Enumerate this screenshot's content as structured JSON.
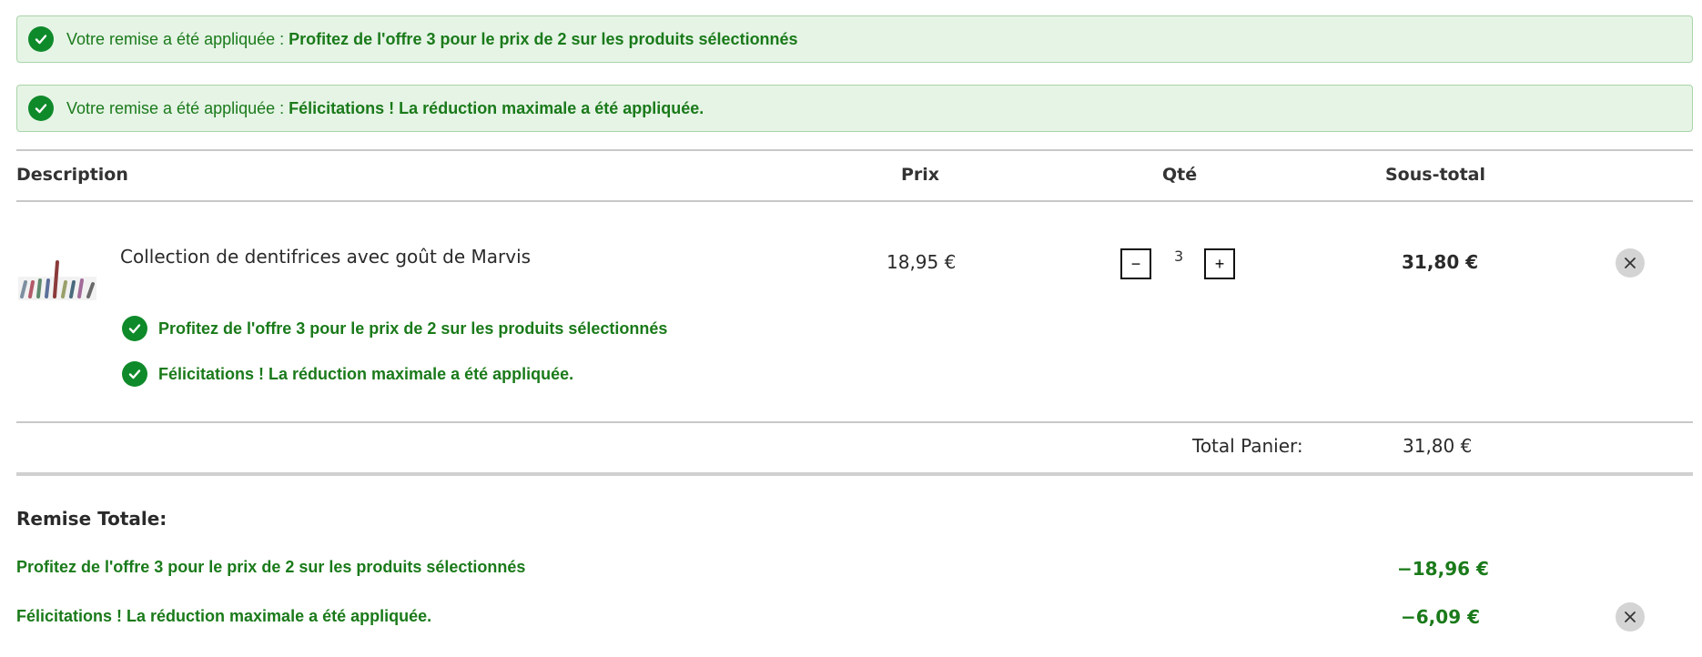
{
  "notices": [
    {
      "prefix": "Votre remise a été appliquée : ",
      "message": "Profitez de l'offre 3 pour le prix de 2 sur les produits sélectionnés"
    },
    {
      "prefix": "Votre remise a été appliquée : ",
      "message": "Félicitations ! La réduction maximale a été appliquée."
    }
  ],
  "table": {
    "headers": {
      "description": "Description",
      "price": "Prix",
      "qty": "Qté",
      "subtotal": "Sous-total"
    }
  },
  "item": {
    "name": "Collection de dentifrices avec goût de Marvis",
    "price": "18,95 €",
    "qty": "3",
    "qty_minus": "−",
    "qty_plus": "+",
    "subtotal": "31,80 €",
    "promos": [
      "Profitez de l'offre 3 pour le prix de 2 sur les produits sélectionnés",
      "Félicitations ! La réduction maximale a été appliquée."
    ]
  },
  "totals": {
    "label": "Total Panier:",
    "value": "31,80 €"
  },
  "discounts": {
    "title": "Remise Totale:",
    "items": [
      {
        "label": "Profitez de l'offre 3 pour le prix de 2 sur les produits sélectionnés",
        "value": "−18,96 €"
      },
      {
        "label": "Félicitations ! La réduction maximale a été appliquée.",
        "value": "−6,09 €"
      }
    ]
  },
  "colors": {
    "success_green": "#1a7a1a",
    "notice_bg": "#e6f4e6",
    "check_bg": "#0f8a2a"
  },
  "icons": {
    "check": "check-circle-icon",
    "remove": "close-icon"
  }
}
